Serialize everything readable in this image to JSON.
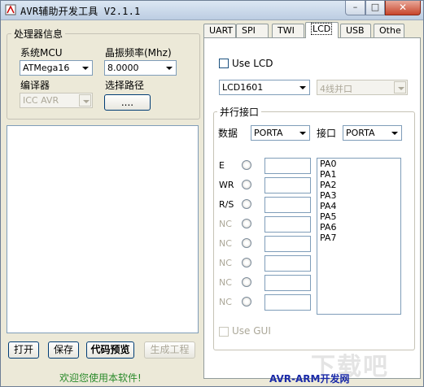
{
  "window": {
    "title": "AVR辅助开发工具 V2.1.1",
    "controls": {
      "minimize": "–",
      "maximize": "□",
      "close": "✕"
    }
  },
  "left": {
    "group_title": "处理器信息",
    "mcu_label": "系统MCU",
    "mcu_value": "ATMega16",
    "freq_label": "晶振频率(Mhz)",
    "freq_value": "8.0000",
    "compiler_label": "编译器",
    "compiler_value": "ICC AVR",
    "path_label": "选择路径",
    "path_button": "....",
    "buttons": {
      "open": "打开",
      "save": "保存",
      "preview": "代码预览",
      "generate": "生成工程"
    }
  },
  "tabs": [
    {
      "label": "UART"
    },
    {
      "label": "SPI"
    },
    {
      "label": "TWI"
    },
    {
      "label": "LCD"
    },
    {
      "label": "USB"
    },
    {
      "label": "Othe"
    }
  ],
  "lcd": {
    "use_lcd": "Use LCD",
    "model_value": "LCD1601",
    "mode_value": "4线并口",
    "parallel_group": "并行接口",
    "data_label": "数据",
    "data_port": "PORTA",
    "iface_label": "接口",
    "iface_port": "PORTA",
    "pins": [
      "E",
      "WR",
      "R/S",
      "NC",
      "NC",
      "NC",
      "NC",
      "NC"
    ],
    "port_list": [
      "PA0",
      "PA1",
      "PA2",
      "PA3",
      "PA4",
      "PA5",
      "PA6",
      "PA7"
    ],
    "use_gui": "Use GUI"
  },
  "footer": {
    "welcome": "欢迎您使用本软件!",
    "site": "AVR-ARM开发网",
    "watermark": "下载吧"
  }
}
